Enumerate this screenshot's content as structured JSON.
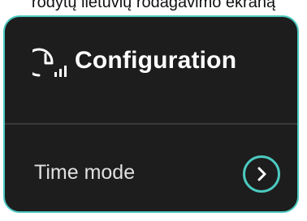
{
  "caption": "rodytų lietuvių rodagavimo ekraną",
  "header": {
    "icon": "clock-stats-icon",
    "title": "Configuration"
  },
  "rows": [
    {
      "label": "Time mode",
      "action_icon": "chevron-right-icon"
    }
  ],
  "colors": {
    "panel_bg": "#1d1d1d",
    "accent": "#4cc9bf",
    "text": "#ffffff",
    "divider": "#3a3a3a"
  }
}
